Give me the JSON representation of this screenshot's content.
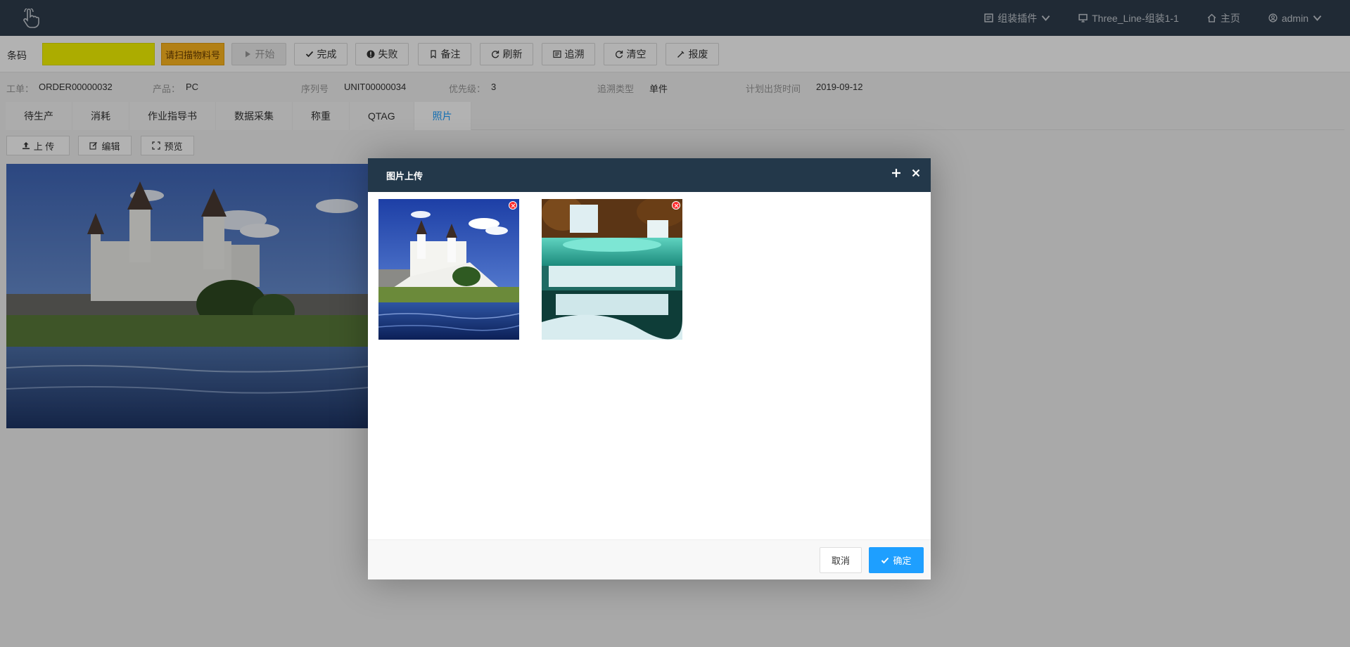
{
  "topbar": {
    "logo_icon": "hand-pointer-icon",
    "menus": [
      {
        "icon": "plugin-icon",
        "label": "组装插件",
        "dropdown": true
      },
      {
        "icon": "monitor-icon",
        "label": "Three_Line-组装1-1",
        "dropdown": false
      },
      {
        "icon": "home-icon",
        "label": "主页",
        "dropdown": false
      },
      {
        "icon": "user-icon",
        "label": "admin",
        "dropdown": true
      }
    ]
  },
  "toolbar": {
    "barcode_label": "条码",
    "barcode_value": "",
    "scan_label": "请扫描物料号",
    "buttons": [
      {
        "icon": "play-icon",
        "label": "开始",
        "disabled": true
      },
      {
        "icon": "check-icon",
        "label": "完成",
        "disabled": false
      },
      {
        "icon": "alert-icon",
        "label": "失败",
        "disabled": false
      },
      {
        "icon": "bookmark-icon",
        "label": "备注",
        "disabled": false
      },
      {
        "icon": "refresh-icon",
        "label": "刷新",
        "disabled": false
      },
      {
        "icon": "trace-icon",
        "label": "追溯",
        "disabled": false
      },
      {
        "icon": "clear-icon",
        "label": "清空",
        "disabled": false
      },
      {
        "icon": "scrap-icon",
        "label": "报废",
        "disabled": false
      }
    ]
  },
  "info": {
    "order_label": "工单：",
    "order_value": "ORDER00000032",
    "product_label": "产品：",
    "product_value": "PC",
    "serial_label": "序列号",
    "serial_value": "UNIT00000034",
    "priority_label": "优先级：",
    "priority_value": "3",
    "trace_type_label": "追溯类型",
    "trace_type_value": "单件",
    "plan_date_label": "计划出货时间",
    "plan_date_value": "2019-09-12"
  },
  "tabs": [
    "待生产",
    "消耗",
    "作业指导书",
    "数据采集",
    "称重",
    "QTAG",
    "照片"
  ],
  "active_tab": "照片",
  "photo_actions": [
    {
      "icon": "upload-icon",
      "label": "上 传"
    },
    {
      "icon": "edit-icon",
      "label": "编辑"
    },
    {
      "icon": "preview-icon",
      "label": "预览"
    }
  ],
  "modal": {
    "title": "图片上传",
    "images": [
      "castle-lake-photo",
      "waterfall-photo"
    ],
    "cancel_label": "取消",
    "ok_label": "确定"
  },
  "colors": {
    "topbar": "#2f3d4c",
    "modal_header": "#23384a",
    "primary": "#1e9fff",
    "barcode_bg": "#f7f700",
    "scan_bg": "#ffb820"
  }
}
